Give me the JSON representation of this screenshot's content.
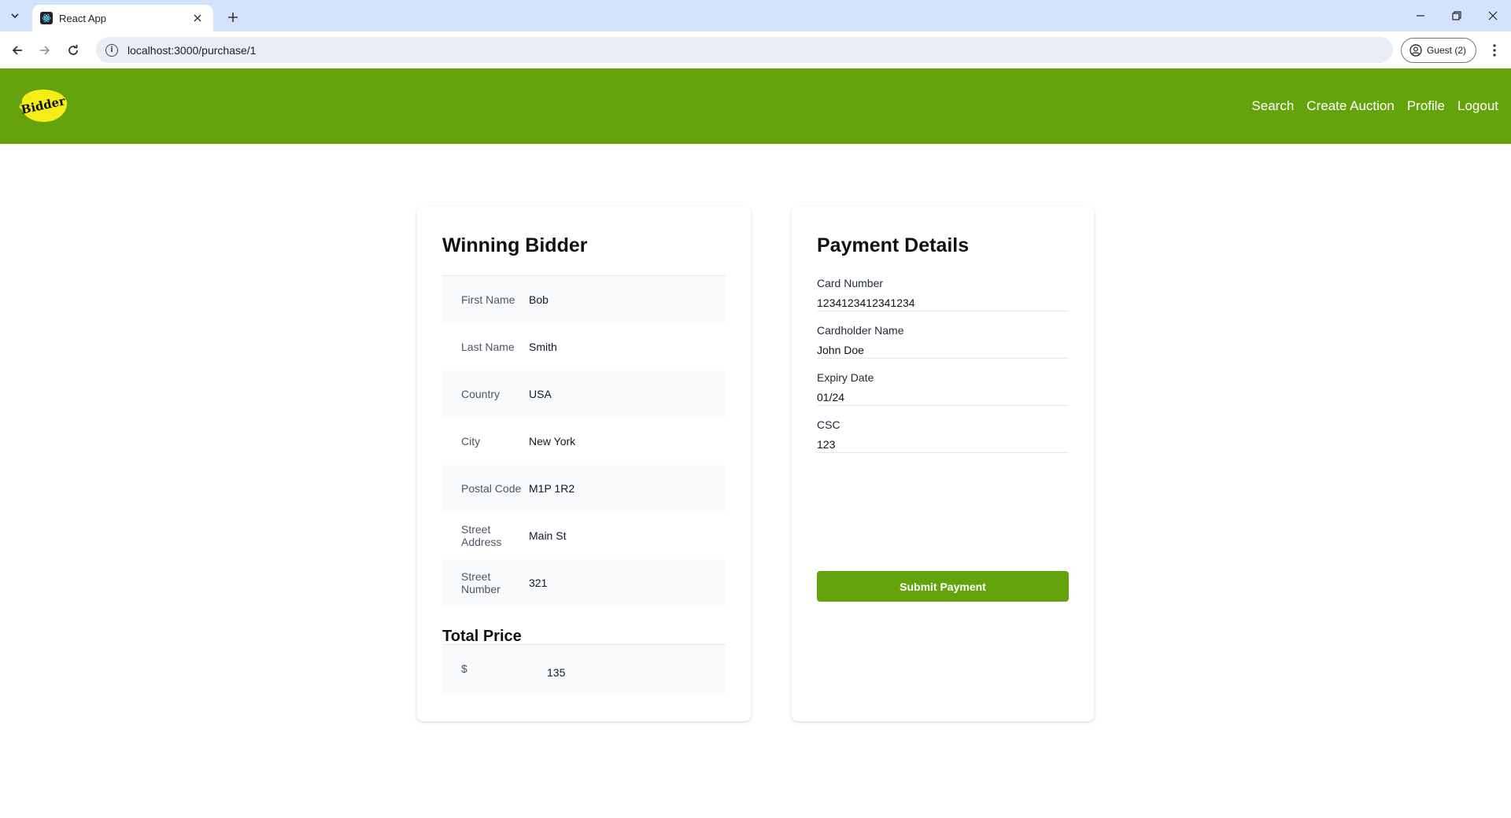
{
  "browser": {
    "tab_title": "React App",
    "url": "localhost:3000/purchase/1",
    "profile_label": "Guest (2)"
  },
  "header": {
    "logo_text": "Bidder",
    "nav": [
      "Search",
      "Create Auction",
      "Profile",
      "Logout"
    ]
  },
  "winning_bidder": {
    "title": "Winning Bidder",
    "rows": [
      {
        "label": "First Name",
        "value": "Bob"
      },
      {
        "label": "Last Name",
        "value": "Smith"
      },
      {
        "label": "Country",
        "value": "USA"
      },
      {
        "label": "City",
        "value": "New York"
      },
      {
        "label": "Postal Code",
        "value": "M1P 1R2"
      },
      {
        "label": "Street Address",
        "value": "Main St"
      },
      {
        "label": "Street Number",
        "value": "321"
      }
    ],
    "total_title": "Total Price",
    "total_label": "$",
    "total_value": "135"
  },
  "payment": {
    "title": "Payment Details",
    "fields": [
      {
        "label": "Card Number",
        "value": "1234123412341234"
      },
      {
        "label": "Cardholder Name",
        "value": "John Doe"
      },
      {
        "label": "Expiry Date",
        "value": "01/24"
      },
      {
        "label": "CSC",
        "value": "123"
      }
    ],
    "submit_label": "Submit Payment"
  },
  "colors": {
    "brand_green": "#65a30d",
    "logo_yellow": "#f5ee16",
    "chrome_tabbar": "#d3e3fd"
  }
}
